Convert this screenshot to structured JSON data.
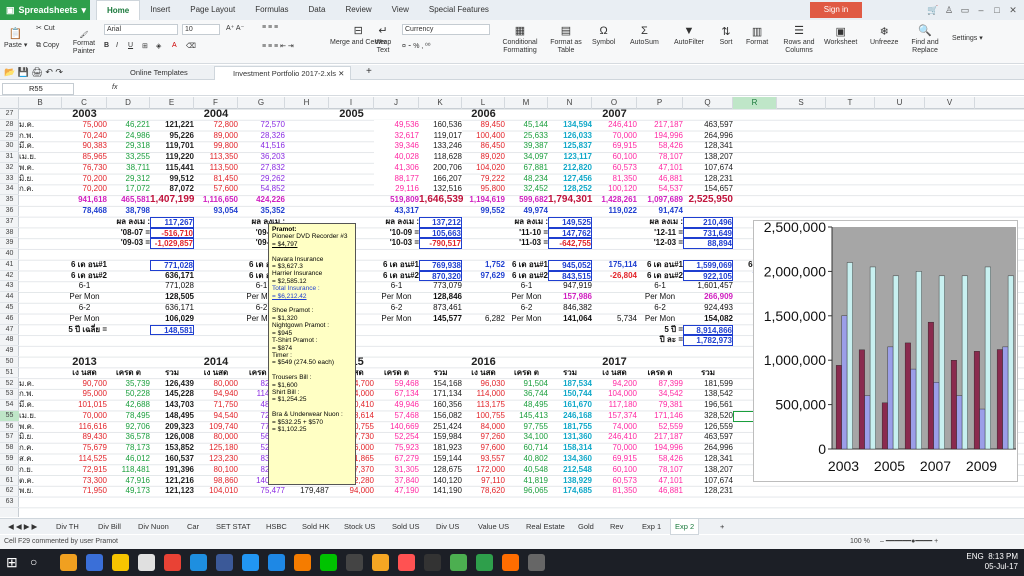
{
  "app": {
    "name": "Spreadsheets",
    "menu_tabs": [
      "Home",
      "Insert",
      "Page Layout",
      "Formulas",
      "Data",
      "Review",
      "View",
      "Special Features"
    ],
    "signin": "Sign in"
  },
  "ribbon": {
    "cut": "Cut",
    "copy": "Copy",
    "paste": "Paste",
    "format_painter": "Format Painter",
    "font": "Arial",
    "size": "10",
    "number_format": "Currency",
    "merge": "Merge and Center",
    "wrap": "Wrap Text",
    "conditional": "Conditional Formatting",
    "format_table": "Format as Table",
    "symbol": "Symbol",
    "autosum": "AutoSum",
    "autofilter": "AutoFilter",
    "sort": "Sort",
    "format": "Format",
    "rows_cols": "Rows and Columns",
    "worksheet": "Worksheet",
    "unfreeze": "Unfreeze",
    "find": "Find and Replace",
    "settings": "Settings"
  },
  "doc_tabs": [
    "Online Templates",
    "Investment Portfolio 2017-2.xls"
  ],
  "formula_bar": {
    "cell": "R55",
    "fx": "fx"
  },
  "columns": [
    "",
    "B",
    "C",
    "D",
    "E",
    "F",
    "G",
    "H",
    "I",
    "J",
    "K",
    "L",
    "M",
    "N",
    "O",
    "P",
    "Q",
    "R",
    "S",
    "T",
    "U",
    "V"
  ],
  "rows": [
    "27",
    "28",
    "29",
    "30",
    "31",
    "32",
    "33",
    "34",
    "35",
    "36",
    "37",
    "38",
    "39",
    "40",
    "41",
    "42",
    "43",
    "44",
    "45",
    "46",
    "47",
    "48",
    "49",
    "50",
    "51",
    "52",
    "53",
    "54",
    "55",
    "56",
    "57",
    "58",
    "59",
    "60",
    "61",
    "62",
    "63"
  ],
  "years_top": [
    "2003",
    "2004",
    "2005",
    "2006",
    "2007"
  ],
  "years_bottom": [
    "2013",
    "2014",
    "2015",
    "2016",
    "2017"
  ],
  "cells": {
    "r28": [
      "ม.ค.",
      "75,000",
      "46,221",
      "121,221",
      "72,800",
      "72,570",
      "",
      "",
      "49,536",
      "160,536",
      "89,450",
      "45,144",
      "134,594",
      "246,410",
      "217,187",
      "463,597"
    ],
    "r29": [
      "ก.พ.",
      "70,240",
      "24,986",
      "95,226",
      "89,000",
      "28,326",
      "",
      "",
      "32,617",
      "119,017",
      "100,400",
      "25,633",
      "126,033",
      "70,000",
      "194,996",
      "264,996"
    ],
    "r30": [
      "มี.ค.",
      "90,383",
      "29,318",
      "119,701",
      "99,800",
      "41,516",
      "",
      "",
      "39,346",
      "133,246",
      "86,450",
      "39,387",
      "125,837",
      "69,915",
      "58,426",
      "128,341"
    ],
    "r31": [
      "เม.ย.",
      "85,965",
      "33,255",
      "119,220",
      "113,350",
      "36,203",
      "",
      "",
      "40,028",
      "118,628",
      "89,020",
      "34,097",
      "123,117",
      "60,100",
      "78,107",
      "138,207"
    ],
    "r32": [
      "พ.ค.",
      "76,730",
      "38,711",
      "115,441",
      "113,500",
      "27,832",
      "",
      "",
      "41,306",
      "200,706",
      "104,020",
      "67,881",
      "212,820",
      "60,573",
      "47,101",
      "107,674"
    ],
    "r33": [
      "มิ.ย.",
      "70,200",
      "29,312",
      "99,512",
      "81,450",
      "29,262",
      "",
      "",
      "88,177",
      "166,207",
      "79,222",
      "48,234",
      "127,456",
      "81,350",
      "46,881",
      "128,231"
    ],
    "r34": [
      "ก.ค.",
      "70,200",
      "17,072",
      "87,072",
      "57,600",
      "54,852",
      "",
      "",
      "29,116",
      "132,516",
      "95,800",
      "32,452",
      "128,252",
      "100,120",
      "54,537",
      "154,657"
    ],
    "r35": [
      "",
      "941,618",
      "465,581",
      "1,407,199",
      "1,116,650",
      "424,226",
      "",
      "",
      "519,809",
      "1,646,539",
      "1,194,619",
      "599,682",
      "1,794,301",
      "1,428,261",
      "1,097,689",
      "2,525,950"
    ],
    "r36": [
      "",
      "78,468",
      "38,798",
      "",
      "93,054",
      "35,352",
      "",
      "",
      "43,317",
      "",
      "99,552",
      "49,974",
      "",
      "119,022",
      "91,474",
      ""
    ],
    "r37": [
      "",
      "",
      "ผล ลงเม :",
      "117,267",
      "",
      "ผล ลงเม :",
      "",
      "",
      "ผล ลงเม :",
      "137,212",
      "",
      "ผล ลงเม :",
      "149,525",
      "",
      "ผล ลงเม :",
      "210,496"
    ],
    "r38": [
      "",
      "",
      "'08-07 =",
      "-516,710",
      "",
      "'09-08 =",
      "",
      "",
      "'10-09 =",
      "105,663",
      "",
      "'11-10 =",
      "147,762",
      "",
      "'12-11 =",
      "731,649"
    ],
    "r39": [
      "",
      "",
      "'09-03 =",
      "-1,029,857",
      "",
      "'09-03 =",
      "",
      "",
      "'10-03 =",
      "-790,517",
      "",
      "'11-03 =",
      "-642,755",
      "",
      "'12-03 =",
      "88,894"
    ],
    "r41": [
      "",
      "6 เด อน#1",
      "",
      "771,028",
      "",
      "6 เด อน#1",
      "",
      "",
      "6 เด อน#1",
      "769,938",
      "1,752",
      "6 เด อน#1",
      "945,052",
      "175,114",
      "6 เด อน#1",
      "1,599,069",
      "654,017"
    ],
    "r42": [
      "",
      "6 เด อน#2",
      "",
      "636,171",
      "",
      "6 เด อน#2",
      "",
      "",
      "6 เด อน#2",
      "870,320",
      "97,629",
      "6 เด อน#2",
      "843,515",
      "-26,804",
      "6 เด อน#2",
      "922,105",
      "78,590"
    ],
    "r43": [
      "",
      "6-1",
      "",
      "771,028",
      "",
      "6-1",
      "",
      "",
      "6-1",
      "773,079",
      "",
      "6-1",
      "947,919",
      "",
      "6-1",
      "1,601,457"
    ],
    "r44": [
      "",
      "Per Mon",
      "",
      "128,505",
      "",
      "Per Mon",
      "",
      "",
      "Per Mon",
      "128,846",
      "",
      "Per Mon",
      "157,986",
      "",
      "Per Mon",
      "266,909"
    ],
    "r45": [
      "",
      "6-2",
      "",
      "636,171",
      "",
      "6-2",
      "",
      "",
      "6-2",
      "873,461",
      "",
      "6-2",
      "846,382",
      "",
      "6-2",
      "924,493"
    ],
    "r46": [
      "",
      "Per Mon",
      "",
      "106,029",
      "",
      "Per Mon",
      "",
      "",
      "Per Mon",
      "145,577",
      "6,282",
      "Per Mon",
      "141,064",
      "5,734",
      "Per Mon",
      "154,082",
      "4,776"
    ],
    "r47": [
      "",
      "5 ปี เฉลี่ย =",
      "",
      "148,581",
      "",
      "",
      "",
      "",
      "",
      "",
      "",
      "",
      "",
      "",
      "5 ปี =",
      "8,914,866"
    ],
    "r48": [
      "",
      "",
      "",
      "",
      "",
      "",
      "",
      "",
      "",
      "",
      "",
      "",
      "",
      "",
      "ปี ละ =",
      "1,782,973"
    ],
    "r51": [
      "",
      "เง นสด",
      "เครด ต",
      "รวม",
      "เง นสด",
      "เครด ต",
      "รวม",
      "เง นสด",
      "เครด ต",
      "รวม",
      "เง นสด",
      "เครด ต",
      "รวม",
      "เง นสด",
      "เครด ต",
      "รวม"
    ],
    "r52": [
      "ม.ค.",
      "90,700",
      "35,739",
      "126,439",
      "80,000",
      "82,314",
      "162,314",
      "94,700",
      "59,468",
      "154,168",
      "96,030",
      "91,504",
      "187,534",
      "94,200",
      "87,399",
      "181,599"
    ],
    "r53": [
      "ก.พ.",
      "95,000",
      "50,228",
      "145,228",
      "94,940",
      "114,069",
      "209,009",
      "104,000",
      "67,134",
      "171,134",
      "114,000",
      "36,744",
      "150,744",
      "104,000",
      "34,542",
      "138,542"
    ],
    "r54": [
      "มี.ค.",
      "101,015",
      "42,688",
      "143,703",
      "71,750",
      "48,947",
      "120,697",
      "110,410",
      "49,946",
      "160,356",
      "113,175",
      "48,495",
      "161,670",
      "117,180",
      "79,381",
      "196,561"
    ],
    "r55": [
      "เม.ย.",
      "70,000",
      "78,495",
      "148,495",
      "94,540",
      "72,467",
      "167,007",
      "98,614",
      "57,468",
      "156,082",
      "100,755",
      "145,413",
      "246,168",
      "157,374",
      "171,146",
      "328,520"
    ],
    "r56": [
      "พ.ค.",
      "116,616",
      "92,706",
      "209,323",
      "109,740",
      "77,249",
      "186,989",
      "110,755",
      "140,669",
      "251,424",
      "84,000",
      "97,755",
      "181,755",
      "74,000",
      "52,559",
      "126,559"
    ],
    "r57": [
      "มิ.ย.",
      "89,430",
      "36,578",
      "126,008",
      "80,000",
      "56,893",
      "136,893",
      "107,730",
      "52,254",
      "159,984",
      "97,260",
      "34,100",
      "131,360",
      "246,410",
      "217,187",
      "463,597"
    ],
    "r58": [
      "ก.ค.",
      "75,679",
      "78,173",
      "153,852",
      "125,180",
      "52,341",
      "177,521",
      "106,000",
      "75,923",
      "181,923",
      "97,600",
      "60,714",
      "158,314",
      "70,000",
      "194,996",
      "264,996"
    ],
    "r59": [
      "ส.ค.",
      "114,525",
      "46,012",
      "160,537",
      "123,230",
      "83,694",
      "206,924",
      "91,865",
      "67,279",
      "159,144",
      "93,557",
      "40,802",
      "134,360",
      "69,915",
      "58,426",
      "128,341"
    ],
    "r60": [
      "ก.ย.",
      "72,915",
      "118,481",
      "191,396",
      "80,100",
      "82,688",
      "162,788",
      "97,370",
      "31,305",
      "128,675",
      "172,000",
      "40,548",
      "212,548",
      "60,100",
      "78,107",
      "138,207"
    ],
    "r61": [
      "ต.ค.",
      "73,300",
      "47,916",
      "121,216",
      "98,860",
      "140,189",
      "239,049",
      "102,280",
      "37,840",
      "140,120",
      "97,110",
      "41,819",
      "138,929",
      "60,573",
      "47,101",
      "107,674"
    ],
    "r62": [
      "พ.ย.",
      "71,950",
      "49,173",
      "121,123",
      "104,010",
      "75,477",
      "179,487",
      "94,000",
      "47,190",
      "141,190",
      "78,620",
      "96,065",
      "174,685",
      "81,350",
      "46,881",
      "128,231"
    ]
  },
  "comment": {
    "author": "Pramot:",
    "lines": [
      "Pioneer DVD Recorder #3",
      "= $4,797",
      "",
      "Navara Insurance",
      "= $3,627.3",
      "Harrier Insurance",
      "= $2,585.12",
      "Total Insurance :",
      "= $6,212.42",
      "",
      "Shoe Pramot :",
      "= $1,320",
      "Nightgown Pramot :",
      "= $945",
      "T-Shirt Pramot :",
      "= $874",
      "Timer :",
      "= $549 (274.50 each)",
      "",
      "Trousers Bill :",
      "= $1,600",
      "Shirt Bill :",
      "= $1,254.25",
      "",
      "Bra & Underwear Nuon :",
      "= $532.25 + $570",
      "= $1,102.25"
    ]
  },
  "chart_data": {
    "type": "bar",
    "categories": [
      "2003",
      "2004",
      "2005",
      "2006",
      "2007",
      "2008",
      "2009",
      "2010"
    ],
    "x_tick_labels": [
      "2003",
      "2005",
      "2007",
      "2009"
    ],
    "ylim": [
      0,
      2500000
    ],
    "y_ticks": [
      "0",
      "500,000",
      "1,000,000",
      "1,500,000",
      "2,000,000",
      "2,500,000"
    ],
    "series": [
      {
        "values": [
          941618,
          1116650,
          519809,
          1194619,
          1428261,
          1000000,
          1100000,
          1120000
        ],
        "color": "#8a2a4e"
      },
      {
        "values": [
          1500000,
          600000,
          1150000,
          900000,
          750000,
          600000,
          450000,
          1150000
        ],
        "color": "#9b9ee8"
      },
      {
        "values": [
          2100000,
          2050000,
          1950000,
          2000000,
          1950000,
          1950000,
          2050000,
          1950000
        ],
        "color": "#c8f0f0"
      }
    ],
    "bg": "#a6a6a6"
  },
  "sheet_tabs": [
    "Div TH",
    "Div Bill",
    "Div Nuon",
    "Car",
    "SET STAT",
    "HSBC",
    "Sold HK",
    "Stock US",
    "Sold US",
    "Div US",
    "Value US",
    "Real Estate",
    "Gold",
    "Rev",
    "Exp 1",
    "Exp 2"
  ],
  "status": {
    "text": "Cell F29 commented by user Pramot",
    "zoom": "100 %"
  },
  "tray": {
    "time": "8:13 PM",
    "date": "05-Jul-17",
    "lang": "ENG"
  }
}
